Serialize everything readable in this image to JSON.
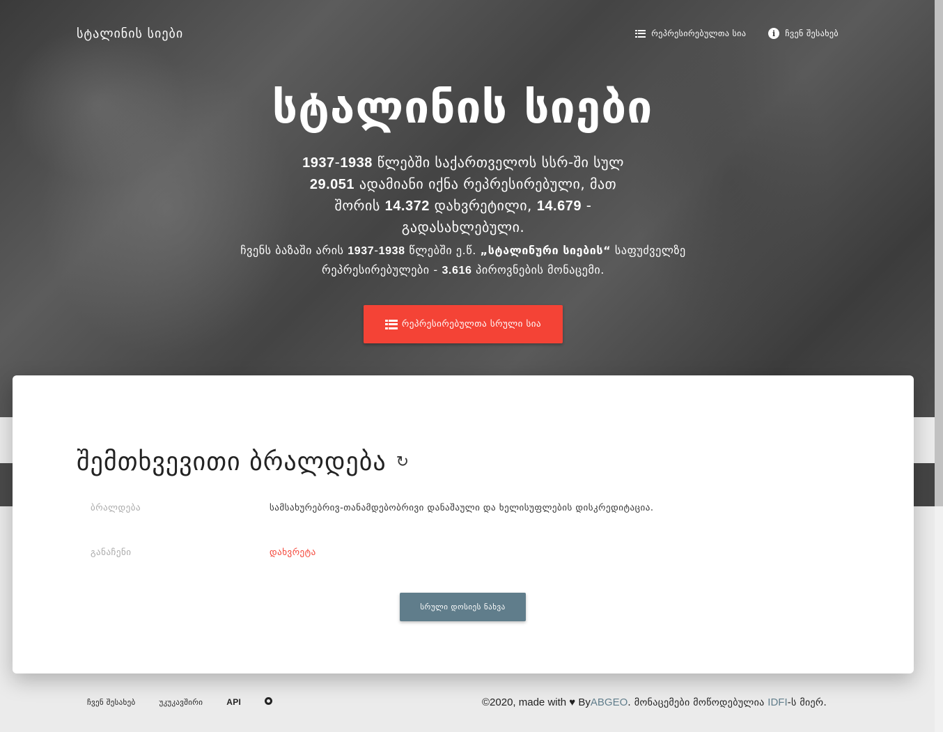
{
  "nav": {
    "brand": "სტალინის სიები",
    "items": [
      {
        "label": "რეპრესირებულთა სია",
        "icon": "list-icon"
      },
      {
        "label": "ჩვენ შესახებ",
        "icon": "info-icon"
      }
    ]
  },
  "hero": {
    "title": "სტალინის სიები",
    "lead": {
      "year_start": "1937",
      "dash": "-",
      "year_end": "1938",
      "text1": " წლებში საქართველოს სსრ-ში სულ ",
      "total": "29.051",
      "text2": " ადამიანი იქნა რეპრესირებული, მათ შორის ",
      "shot": "14.372",
      "text3": " დახვრეტილი, ",
      "deported": "14.679",
      "text4": " - გადასახლებული."
    },
    "sub": {
      "text1": "ჩვენს ბაზაში არის ",
      "year_start": "1937",
      "dash": "-",
      "year_end": "1938",
      "text2": " წლებში ე.წ. ",
      "quote": "„სტალინური სიების“",
      "text3": " საფუძველზე რეპრესირებულები - ",
      "count": "3.616",
      "text4": " პიროვნების მონაცემი."
    },
    "cta_label": "რეპრესირებულთა სრული სია"
  },
  "random_case": {
    "title": "შემთხვევითი ბრალდება",
    "refresh_icon": "refresh-icon",
    "rows": [
      {
        "label": "ბრალდება",
        "value": "სამსახურებრივ-თანამდებობრივი დანაშაული და ხელისუფლების დისკრედიტაცია."
      },
      {
        "label": "განაჩენი",
        "value": "დახვრეტა"
      }
    ],
    "dossier_button": "სრული დოსიეს ნახვა"
  },
  "footer": {
    "links": [
      {
        "label": "ჩვენ შესახებ"
      },
      {
        "label": "უკუკავშირი"
      },
      {
        "label": "API"
      }
    ],
    "github_icon": "github-icon",
    "copyright_prefix": "©2020, made with",
    "by": "By",
    "author": "ABGEO",
    "data_text": ". მონაცემები მოწოდებულია ",
    "source": "IDFI",
    "source_suffix": "-ს მიერ."
  },
  "colors": {
    "accent_red": "#f44336",
    "button_gray": "#607d8b"
  }
}
